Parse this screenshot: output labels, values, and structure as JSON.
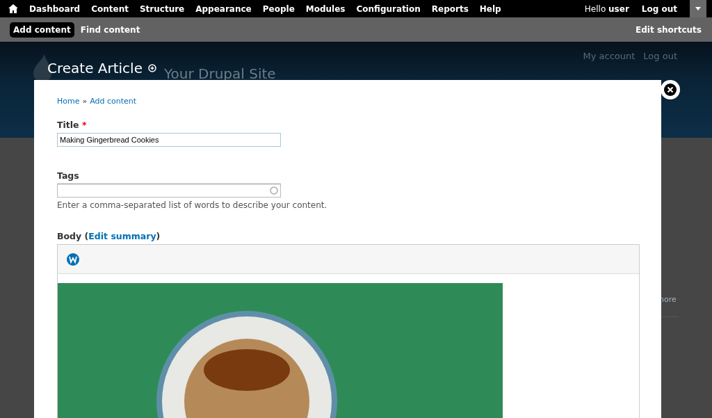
{
  "toolbar": {
    "menu": [
      {
        "label": "Dashboard"
      },
      {
        "label": "Content"
      },
      {
        "label": "Structure"
      },
      {
        "label": "Appearance"
      },
      {
        "label": "People"
      },
      {
        "label": "Modules"
      },
      {
        "label": "Configuration"
      },
      {
        "label": "Reports"
      },
      {
        "label": "Help"
      }
    ],
    "greeting": "Hello",
    "user": "user",
    "logout": "Log out"
  },
  "shortcuts": {
    "items": [
      {
        "label": "Add content",
        "selected": true
      },
      {
        "label": "Find content",
        "selected": false
      }
    ],
    "edit": "Edit shortcuts"
  },
  "background_page": {
    "site_name": "Your Drupal Site",
    "links": [
      "My account",
      "Log out"
    ],
    "more_link": "nore"
  },
  "overlay": {
    "title": "Create Article",
    "breadcrumb": [
      "Home",
      "Add content"
    ],
    "separator": "»",
    "required_mark": "*",
    "fields": [
      {
        "kind": "text",
        "label": "Title",
        "required": true,
        "value": "Making Gingerbread Cookies"
      },
      {
        "kind": "autocomplete",
        "label": "Tags",
        "required": false,
        "description": "Enter a comma-separated list of words to describe your content."
      }
    ],
    "body": {
      "label": "Body",
      "open": "(",
      "summary_link": "Edit summary",
      "close": ")"
    }
  }
}
